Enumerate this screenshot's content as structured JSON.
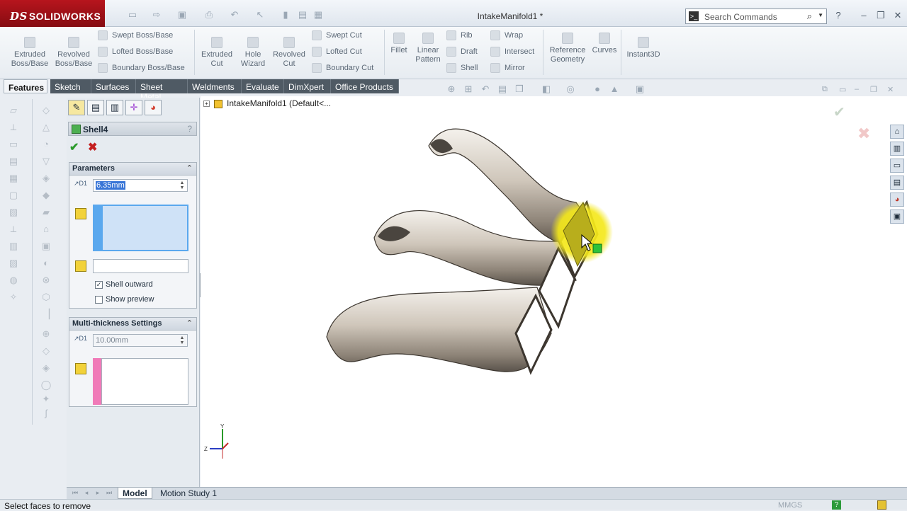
{
  "app": {
    "name": "SOLIDWORKS",
    "doc_title": "IntakeManifold1 *"
  },
  "search": {
    "placeholder": "Search Commands"
  },
  "ribbon": {
    "large": [
      {
        "name": "extruded-boss-button",
        "label": "Extruded Boss/Base"
      },
      {
        "name": "revolved-boss-button",
        "label": "Revolved Boss/Base"
      },
      {
        "name": "extruded-cut-button",
        "label": "Extruded Cut"
      },
      {
        "name": "hole-wizard-button",
        "label": "Hole Wizard"
      },
      {
        "name": "revolved-cut-button",
        "label": "Revolved Cut"
      },
      {
        "name": "fillet-button",
        "label": "Fillet"
      },
      {
        "name": "linear-pattern-button",
        "label": "Linear Pattern"
      },
      {
        "name": "reference-geometry-button",
        "label": "Reference Geometry"
      },
      {
        "name": "curves-button",
        "label": "Curves"
      },
      {
        "name": "instant3d-button",
        "label": "Instant3D"
      }
    ],
    "small": [
      {
        "name": "swept-boss-button",
        "label": "Swept Boss/Base"
      },
      {
        "name": "lofted-boss-button",
        "label": "Lofted Boss/Base"
      },
      {
        "name": "boundary-boss-button",
        "label": "Boundary Boss/Base"
      },
      {
        "name": "swept-cut-button",
        "label": "Swept Cut"
      },
      {
        "name": "lofted-cut-button",
        "label": "Lofted Cut"
      },
      {
        "name": "boundary-cut-button",
        "label": "Boundary Cut"
      },
      {
        "name": "rib-button",
        "label": "Rib"
      },
      {
        "name": "draft-button",
        "label": "Draft"
      },
      {
        "name": "shell-button",
        "label": "Shell"
      },
      {
        "name": "wrap-button",
        "label": "Wrap"
      },
      {
        "name": "intersect-button",
        "label": "Intersect"
      },
      {
        "name": "mirror-button",
        "label": "Mirror"
      }
    ]
  },
  "tabs": [
    "Features",
    "Sketch",
    "Surfaces",
    "Sheet Metal",
    "Weldments",
    "Evaluate",
    "DimXpert",
    "Office Products"
  ],
  "pm": {
    "title": "Shell4",
    "help": "?",
    "parameters": {
      "header": "Parameters",
      "thickness_value": "6.35mm",
      "dim_label": "D1",
      "shell_outward_label": "Shell outward",
      "shell_outward_checked": true,
      "show_preview_label": "Show preview",
      "show_preview_checked": false
    },
    "multi": {
      "header": "Multi-thickness Settings",
      "thickness_value": "10.00mm",
      "dim_label": "D1"
    }
  },
  "tree": {
    "root": "IntakeManifold1  (Default<..."
  },
  "triad": {
    "y": "Y",
    "z": "Z"
  },
  "bottom_tabs": [
    "Model",
    "Motion Study 1"
  ],
  "status": {
    "message": "Select faces to remove",
    "units": "MMGS"
  },
  "colors": {
    "accent_red": "#b7151d",
    "selection_blue": "#5aa8ee",
    "highlight_yellow": "#f4e81a",
    "stripe_pink": "#f07ab8"
  }
}
